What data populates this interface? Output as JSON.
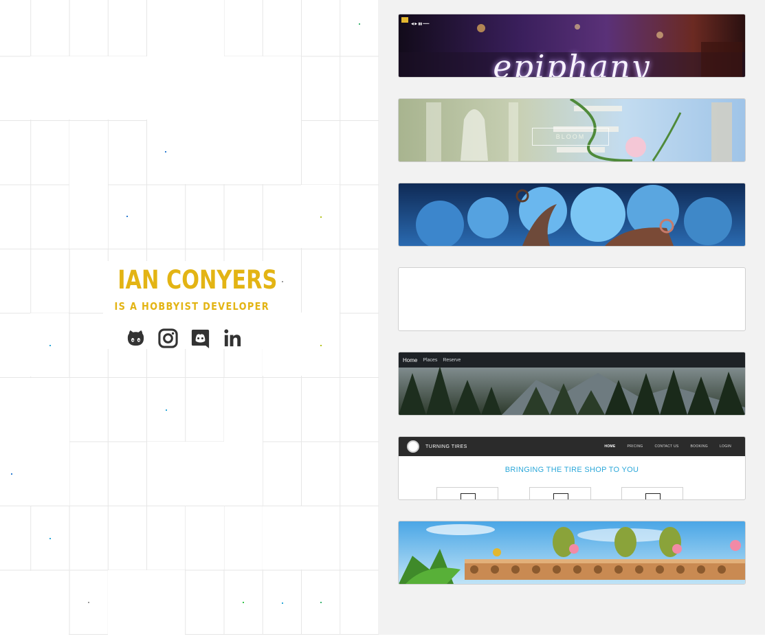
{
  "profile": {
    "name": "IAN CONYERS",
    "tagline": "IS A HOBBYIST DEVELOPER",
    "accent_color": "#e3b414"
  },
  "socials": [
    {
      "icon": "github-icon",
      "label": "GitHub"
    },
    {
      "icon": "instagram-icon",
      "label": "Instagram"
    },
    {
      "icon": "discord-icon",
      "label": "Discord"
    },
    {
      "icon": "linkedin-icon",
      "label": "LinkedIn"
    }
  ],
  "projects": {
    "p1": {
      "title_art": "epiphany",
      "toolbar_text": "◀ ▶ ▮▮ ━━━"
    },
    "p2": {
      "title_art": "BLOOM",
      "sub_text": "— — — — — —"
    },
    "p3": {},
    "p4": {},
    "p5": {
      "nav": [
        "Home",
        "Places",
        "Reserve"
      ]
    },
    "p6": {
      "brand": "TURNING TIRES",
      "nav": [
        "HOME",
        "PRICING",
        "CONTACT US",
        "BOOKING",
        "LOGIN"
      ],
      "heading": "BRINGING THE TIRE SHOP TO YOU"
    },
    "p7": {}
  }
}
